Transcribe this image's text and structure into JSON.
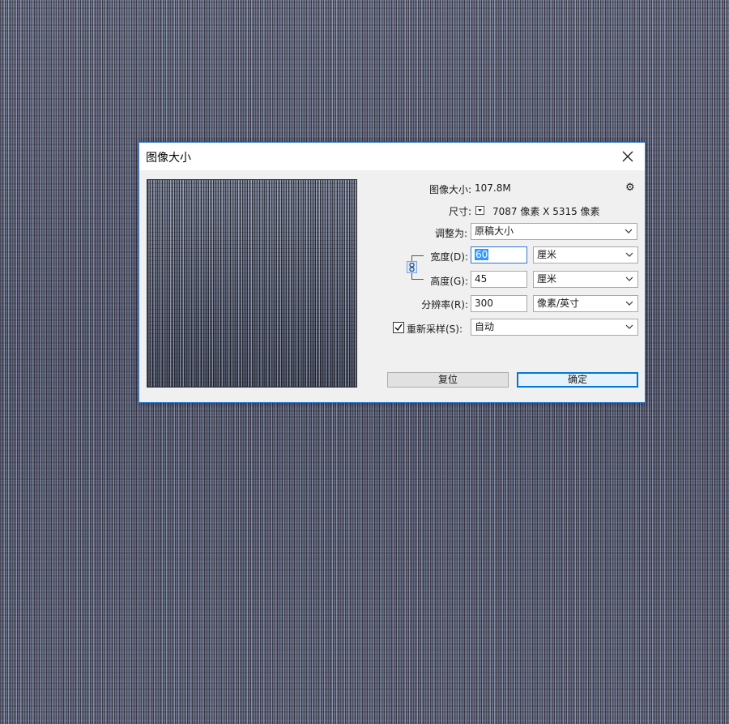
{
  "dialog": {
    "title": "图像大小",
    "close_symbol": "×",
    "gear_symbol": "⚙"
  },
  "info": {
    "size_label": "图像大小:",
    "size_value": "107.8M",
    "dimensions_label": "尺寸:",
    "dimensions_value": "7087 像素  X  5315 像素"
  },
  "fit": {
    "label": "调整为:",
    "value": "原稿大小"
  },
  "width": {
    "label": "宽度(D):",
    "value": "60",
    "unit": "厘米"
  },
  "height": {
    "label": "高度(G):",
    "value": "45",
    "unit": "厘米"
  },
  "resolution": {
    "label": "分辨率(R):",
    "value": "300",
    "unit": "像素/英寸"
  },
  "resample": {
    "label": "重新采样(S):",
    "checked": true,
    "value": "自动"
  },
  "buttons": {
    "reset": "复位",
    "ok": "确定"
  },
  "icons": {
    "close": "close-icon",
    "gear": "gear-icon",
    "link": "link-icon",
    "chevron": "chevron-down-icon",
    "check": "checkmark-icon"
  }
}
